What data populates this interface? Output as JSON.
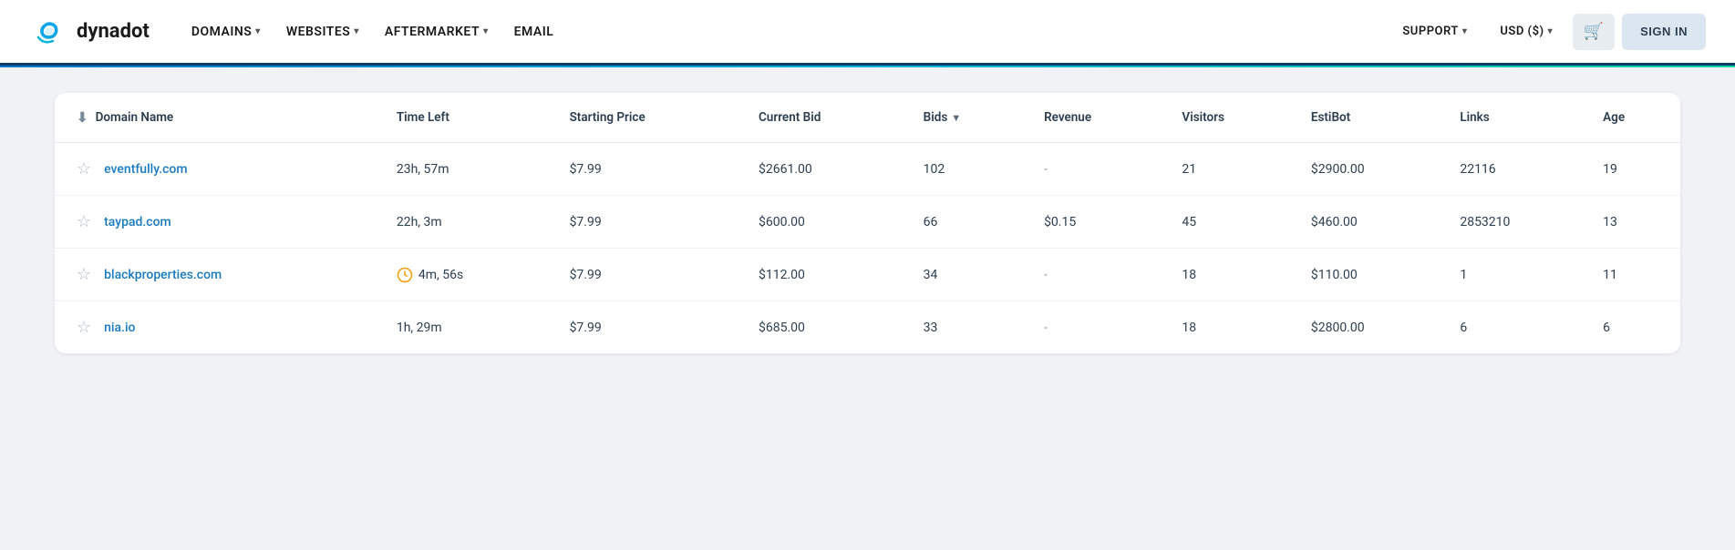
{
  "header": {
    "logo_text": "dynadot",
    "nav_items": [
      {
        "label": "DOMAINS",
        "has_dropdown": true
      },
      {
        "label": "WEBSITES",
        "has_dropdown": true
      },
      {
        "label": "AFTERMARKET",
        "has_dropdown": true
      },
      {
        "label": "EMAIL",
        "has_dropdown": false
      }
    ],
    "right_items": [
      {
        "label": "SUPPORT",
        "has_dropdown": true
      },
      {
        "label": "USD ($)",
        "has_dropdown": true
      }
    ],
    "cart_label": "🛒",
    "signin_label": "SIGN IN"
  },
  "table": {
    "columns": [
      {
        "key": "domain_name",
        "label": "Domain Name",
        "has_sort": true
      },
      {
        "key": "time_left",
        "label": "Time Left"
      },
      {
        "key": "starting_price",
        "label": "Starting Price"
      },
      {
        "key": "current_bid",
        "label": "Current Bid"
      },
      {
        "key": "bids",
        "label": "Bids",
        "has_sort": true
      },
      {
        "key": "revenue",
        "label": "Revenue"
      },
      {
        "key": "visitors",
        "label": "Visitors"
      },
      {
        "key": "estibot",
        "label": "EstiBot"
      },
      {
        "key": "links",
        "label": "Links"
      },
      {
        "key": "age",
        "label": "Age"
      }
    ],
    "rows": [
      {
        "domain": "eventfully.com",
        "time_left": "23h, 57m",
        "has_clock": false,
        "starting_price": "$7.99",
        "current_bid": "$2661.00",
        "bids": "102",
        "revenue": "-",
        "visitors": "21",
        "estibot": "$2900.00",
        "links": "22116",
        "age": "19"
      },
      {
        "domain": "taypad.com",
        "time_left": "22h, 3m",
        "has_clock": false,
        "starting_price": "$7.99",
        "current_bid": "$600.00",
        "bids": "66",
        "revenue": "$0.15",
        "visitors": "45",
        "estibot": "$460.00",
        "links": "2853210",
        "age": "13"
      },
      {
        "domain": "blackproperties.com",
        "time_left": "4m, 56s",
        "has_clock": true,
        "starting_price": "$7.99",
        "current_bid": "$112.00",
        "bids": "34",
        "revenue": "-",
        "visitors": "18",
        "estibot": "$110.00",
        "links": "1",
        "age": "11"
      },
      {
        "domain": "nia.io",
        "time_left": "1h, 29m",
        "has_clock": false,
        "starting_price": "$7.99",
        "current_bid": "$685.00",
        "bids": "33",
        "revenue": "-",
        "visitors": "18",
        "estibot": "$2800.00",
        "links": "6",
        "age": "6"
      }
    ]
  }
}
